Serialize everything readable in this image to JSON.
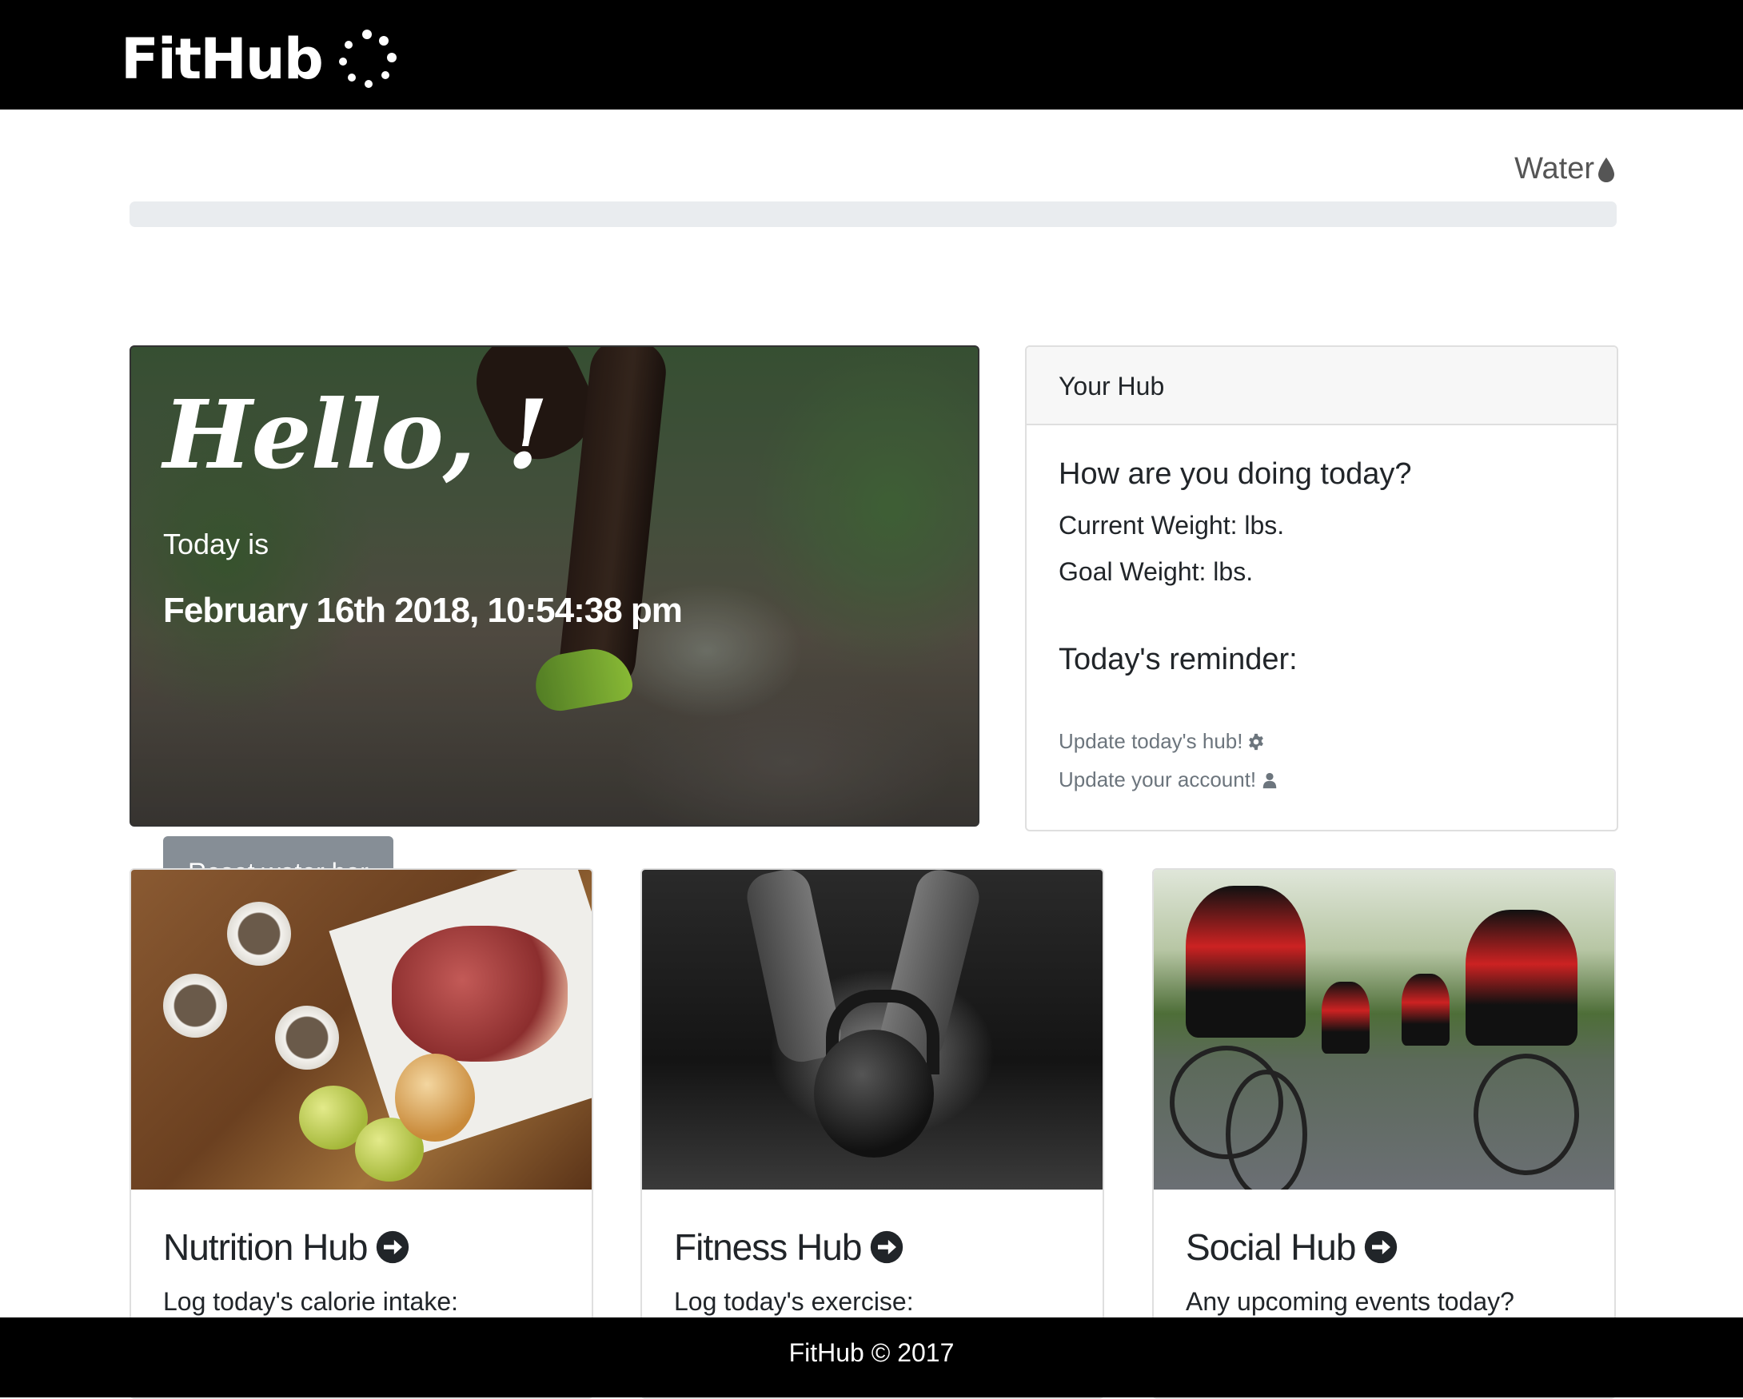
{
  "brand": {
    "name": "FitHub"
  },
  "water": {
    "label": "Water",
    "progress_percent": 0
  },
  "hero": {
    "greeting": "Hello, !",
    "today_is": "Today is",
    "datetime": "February 16th 2018, 10:54:38 pm",
    "reset_button": "Reset water bar"
  },
  "hub": {
    "header": "Your Hub",
    "question": "How are you doing today?",
    "current_weight": "Current Weight: lbs.",
    "goal_weight": "Goal Weight: lbs.",
    "reminder_title": "Today's reminder:",
    "link_update_hub": "Update today's hub!",
    "link_update_account": "Update your account!"
  },
  "tiles": [
    {
      "title": "Nutrition Hub",
      "subtitle": "Log today's calorie intake:"
    },
    {
      "title": "Fitness Hub",
      "subtitle": "Log today's exercise:"
    },
    {
      "title": "Social Hub",
      "subtitle": "Any upcoming events today?"
    }
  ],
  "footer": {
    "text": "FitHub © 2017"
  },
  "icons": {
    "brand": "dots-ring-logo-icon",
    "water": "water-drop-icon",
    "hub_link": "gear-icon",
    "account_link": "user-icon",
    "tile_arrow": "arrow-circle-right-icon"
  },
  "colors": {
    "navbar": "#000000",
    "muted_text": "#6c757d",
    "progress_track": "#e9ecef",
    "button": "#868e96"
  }
}
